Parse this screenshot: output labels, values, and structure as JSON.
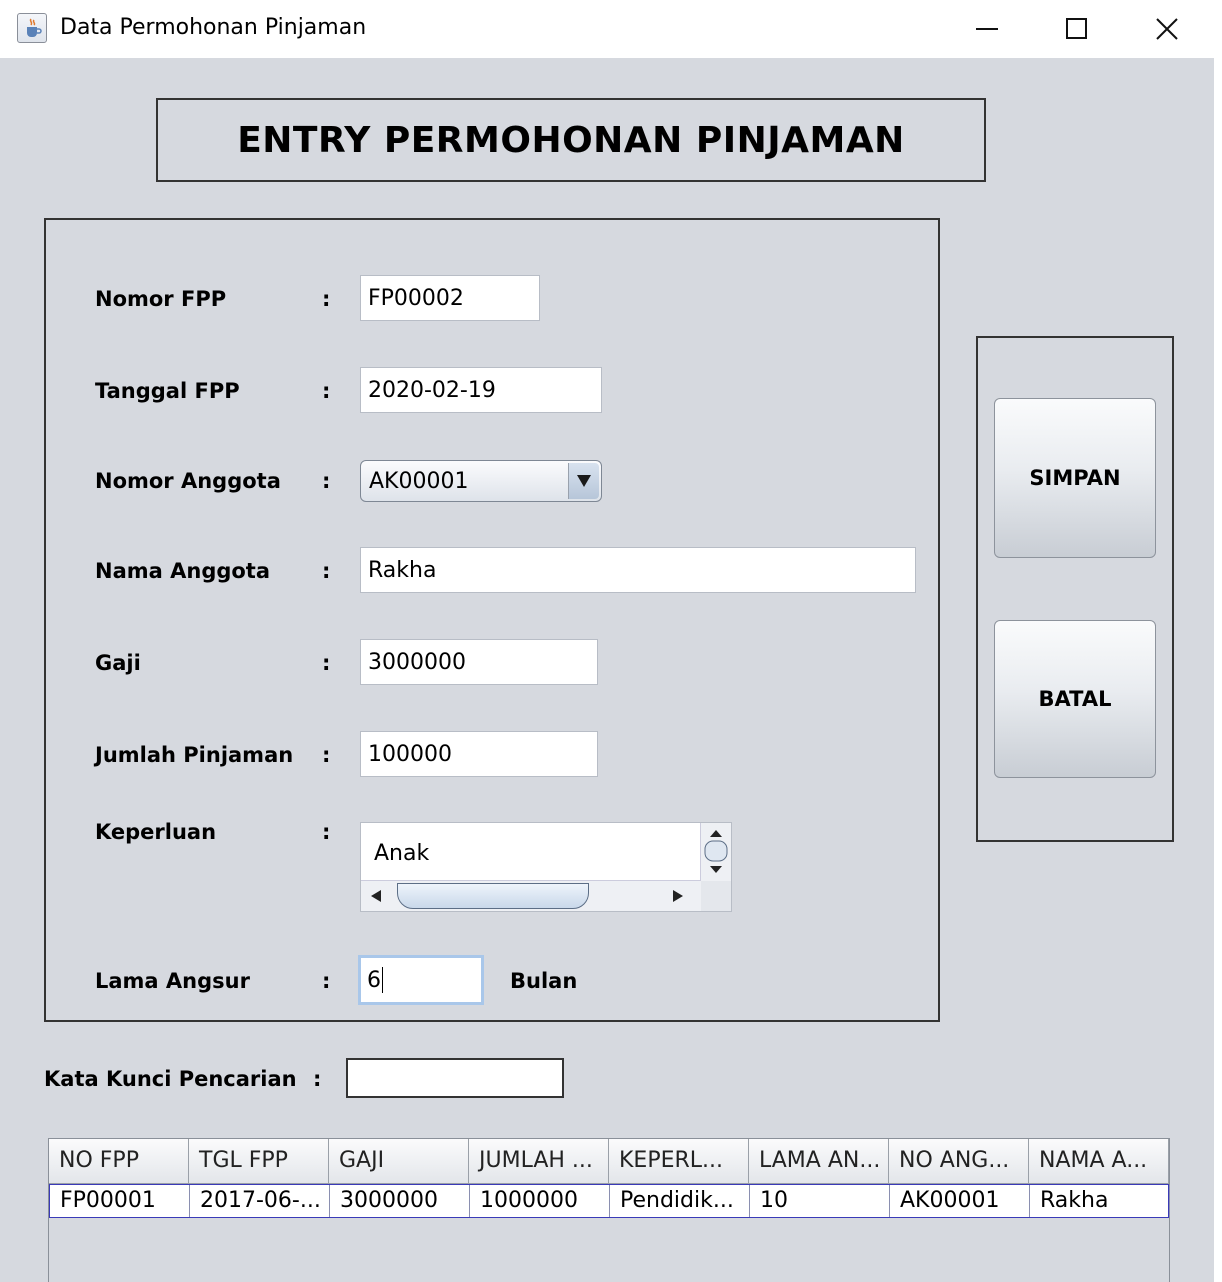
{
  "window": {
    "title": "Data Permohonan Pinjaman",
    "icon": "java-cup-icon",
    "controls": [
      "minimize-icon",
      "maximize-icon",
      "close-icon"
    ]
  },
  "header": {
    "title": "ENTRY PERMOHONAN PINJAMAN"
  },
  "form": {
    "colon": ":",
    "nomor_fpp": {
      "label": "Nomor FPP",
      "value": "FP00002"
    },
    "tanggal_fpp": {
      "label": "Tanggal FPP",
      "value": "2020-02-19"
    },
    "nomor_anggota": {
      "label": "Nomor Anggota",
      "value": "AK00001"
    },
    "nama_anggota": {
      "label": "Nama Anggota",
      "value": "Rakha"
    },
    "gaji": {
      "label": "Gaji",
      "value": "3000000"
    },
    "jumlah_pinjaman": {
      "label": "Jumlah Pinjaman",
      "value": "100000"
    },
    "keperluan": {
      "label": "Keperluan",
      "items": [
        "Anak"
      ]
    },
    "lama_angsur": {
      "label": "Lama Angsur",
      "value": "6",
      "unit": "Bulan"
    }
  },
  "actions": {
    "save_label": "SIMPAN",
    "cancel_label": "BATAL"
  },
  "search": {
    "label": "Kata Kunci Pencarian",
    "value": ""
  },
  "table": {
    "columns": [
      "NO FPP",
      "TGL FPP",
      "GAJI",
      "JUMLAH ...",
      "KEPERL...",
      "LAMA AN...",
      "NO ANG...",
      "NAMA A..."
    ],
    "rows": [
      [
        "FP00001",
        "2017-06-...",
        "3000000",
        "1000000",
        "Pendidik...",
        "10",
        "AK00001",
        "Rakha"
      ]
    ]
  }
}
